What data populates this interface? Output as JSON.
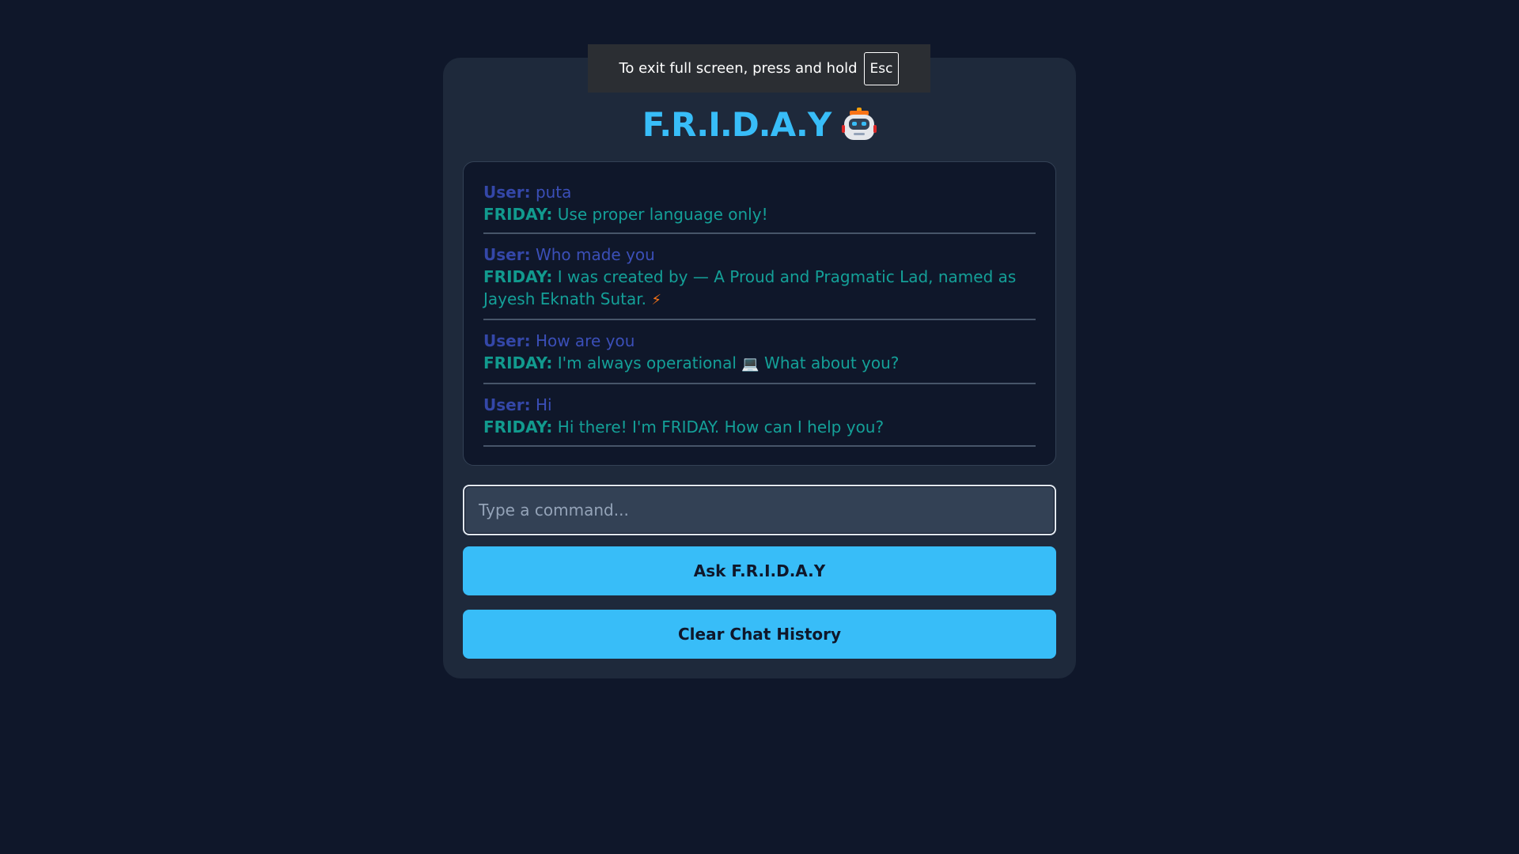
{
  "app": {
    "title": "F.R.I.D.A.Y",
    "title_icon": "robot-icon"
  },
  "fullscreen_toast": {
    "text": "To exit full screen, press and hold",
    "key": "Esc"
  },
  "chat": {
    "messages": [
      {
        "user_label": "User:",
        "user_text": "puta",
        "bot_label": "FRIDAY:",
        "bot_text": "Use proper language only!"
      },
      {
        "user_label": "User:",
        "user_text": "Who made you",
        "bot_label": "FRIDAY:",
        "bot_text": "I was created by — A Proud and Pragmatic Lad, named as Jayesh Eknath Sutar.",
        "bot_emoji": "⚡"
      },
      {
        "user_label": "User:",
        "user_text": "How are you",
        "bot_label": "FRIDAY:",
        "bot_text": "I'm always operational",
        "bot_emoji": "💻",
        "bot_text_after": "What about you?"
      },
      {
        "user_label": "User:",
        "user_text": "Hi",
        "bot_label": "FRIDAY:",
        "bot_text": "Hi there! I'm FRIDAY. How can I help you?"
      }
    ]
  },
  "input": {
    "placeholder": "Type a command..."
  },
  "buttons": {
    "ask_label": "Ask F.R.I.D.A.Y",
    "clear_label": "Clear Chat History"
  },
  "colors": {
    "background": "#0f172a",
    "card": "#1e293b",
    "accent": "#38bdf8",
    "user_text": "#3b4fb8",
    "bot_text": "#14a098"
  }
}
